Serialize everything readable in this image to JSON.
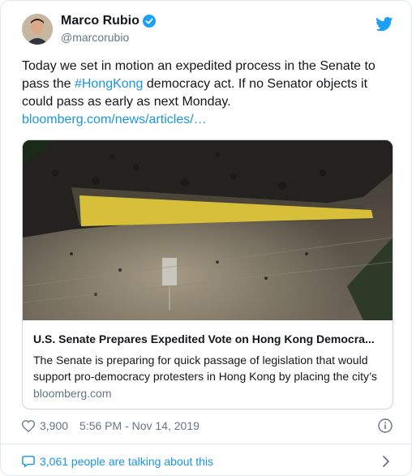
{
  "tweet": {
    "author_name": "Marco Rubio",
    "author_handle": "@marcorubio",
    "text_before": "Today we set in motion an expedited process in the Senate to pass the ",
    "hashtag": "#HongKong",
    "text_after": " democracy act. If no Senator objects it could pass as early as next Monday.",
    "link": "bloomberg.com/news/articles/…"
  },
  "link_card": {
    "title": "U.S. Senate Prepares Expedited Vote on Hong Kong Democra...",
    "description": "The Senate is preparing for quick passage of legislation that would support pro-democracy protesters in Hong Kong by placing the city’s",
    "domain": "bloomberg.com"
  },
  "meta": {
    "likes": "3,900",
    "timestamp": "5:56 PM - Nov 14, 2019"
  },
  "footer": {
    "talking": "3,061 people are talking about this"
  },
  "colors": {
    "link_blue": "#1b95e0",
    "muted_gray": "#657786",
    "border": "#e1e8ed"
  },
  "icons": [
    "verified-badge-icon",
    "twitter-bird-icon",
    "heart-icon",
    "info-icon",
    "speech-bubble-icon",
    "chevron-right-icon"
  ]
}
